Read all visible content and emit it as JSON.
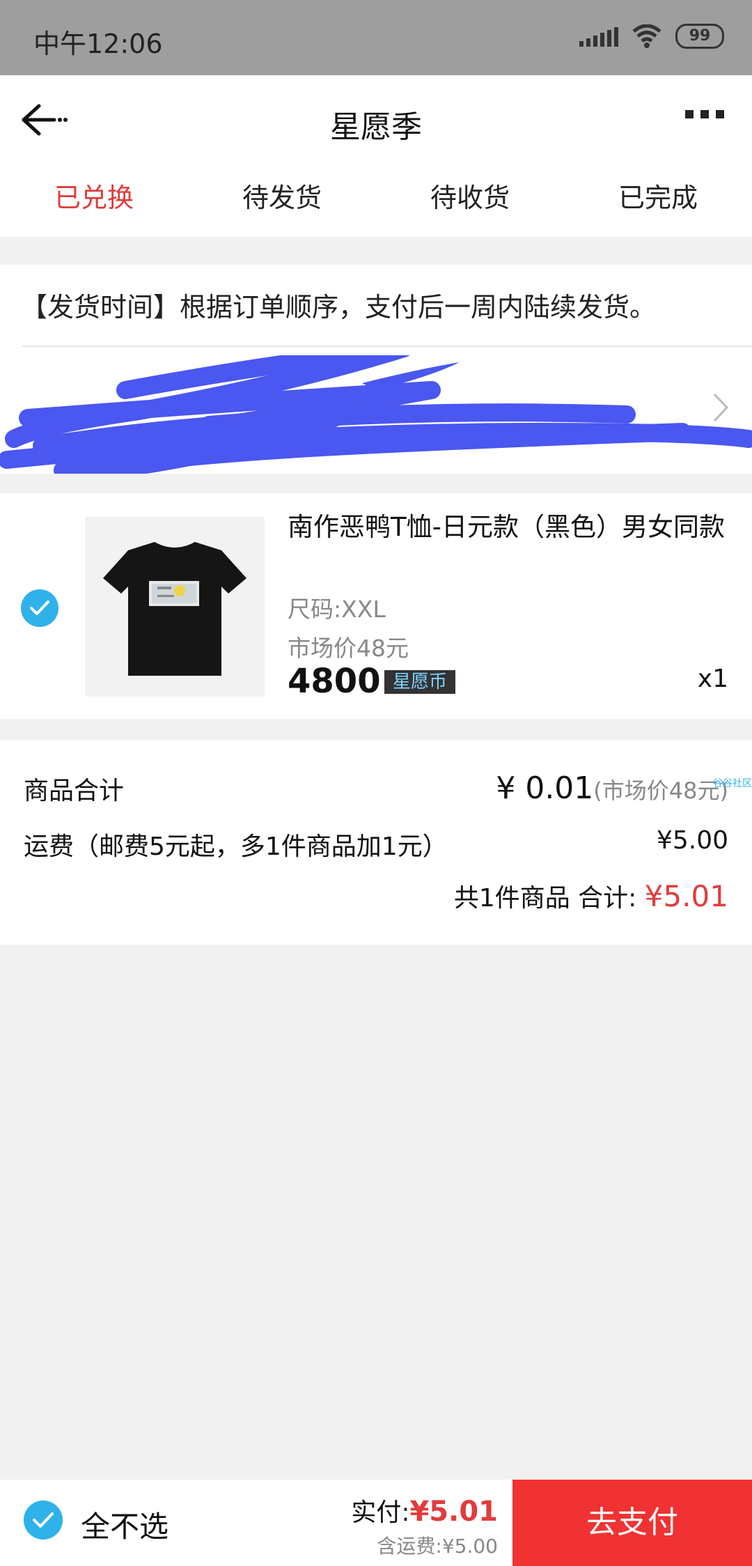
{
  "status_bar": {
    "time": "中午12:06",
    "battery": "99"
  },
  "nav": {
    "title": "星愿季"
  },
  "tabs": [
    {
      "label": "已兑换",
      "active": true
    },
    {
      "label": "待发货",
      "active": false
    },
    {
      "label": "待收货",
      "active": false
    },
    {
      "label": "已完成",
      "active": false
    }
  ],
  "notice": {
    "text": "【发货时间】根据订单顺序，支付后一周内陆续发货。"
  },
  "product": {
    "name": "南作恶鸭T恤-日元款（黑色）男女同款",
    "size": "尺码:XXL",
    "market_price": "市场价48元",
    "price": "4800",
    "currency_badge": "星愿币",
    "quantity": "x1"
  },
  "summary": {
    "goods_total_label": "商品合计",
    "goods_total_amount": "¥ 0.01",
    "goods_total_market": "(市场价48元)",
    "shipping_label": "运费（邮费5元起，多1件商品加1元）",
    "shipping_value": "¥5.00",
    "count_text": "共1件商品  合计: ",
    "total_value": "¥5.01",
    "corner_tag": "谷谷社区"
  },
  "bottom_bar": {
    "select_label": "全不选",
    "paid_label": "实付:",
    "paid_value": "¥5.01",
    "shipping_note": "含运费:¥5.00",
    "pay_button": "去支付"
  },
  "colors": {
    "accent_red": "#e23b3b",
    "pay_button": "#f03232",
    "check_blue": "#2fb1ea",
    "scribble": "#4a57f0"
  }
}
